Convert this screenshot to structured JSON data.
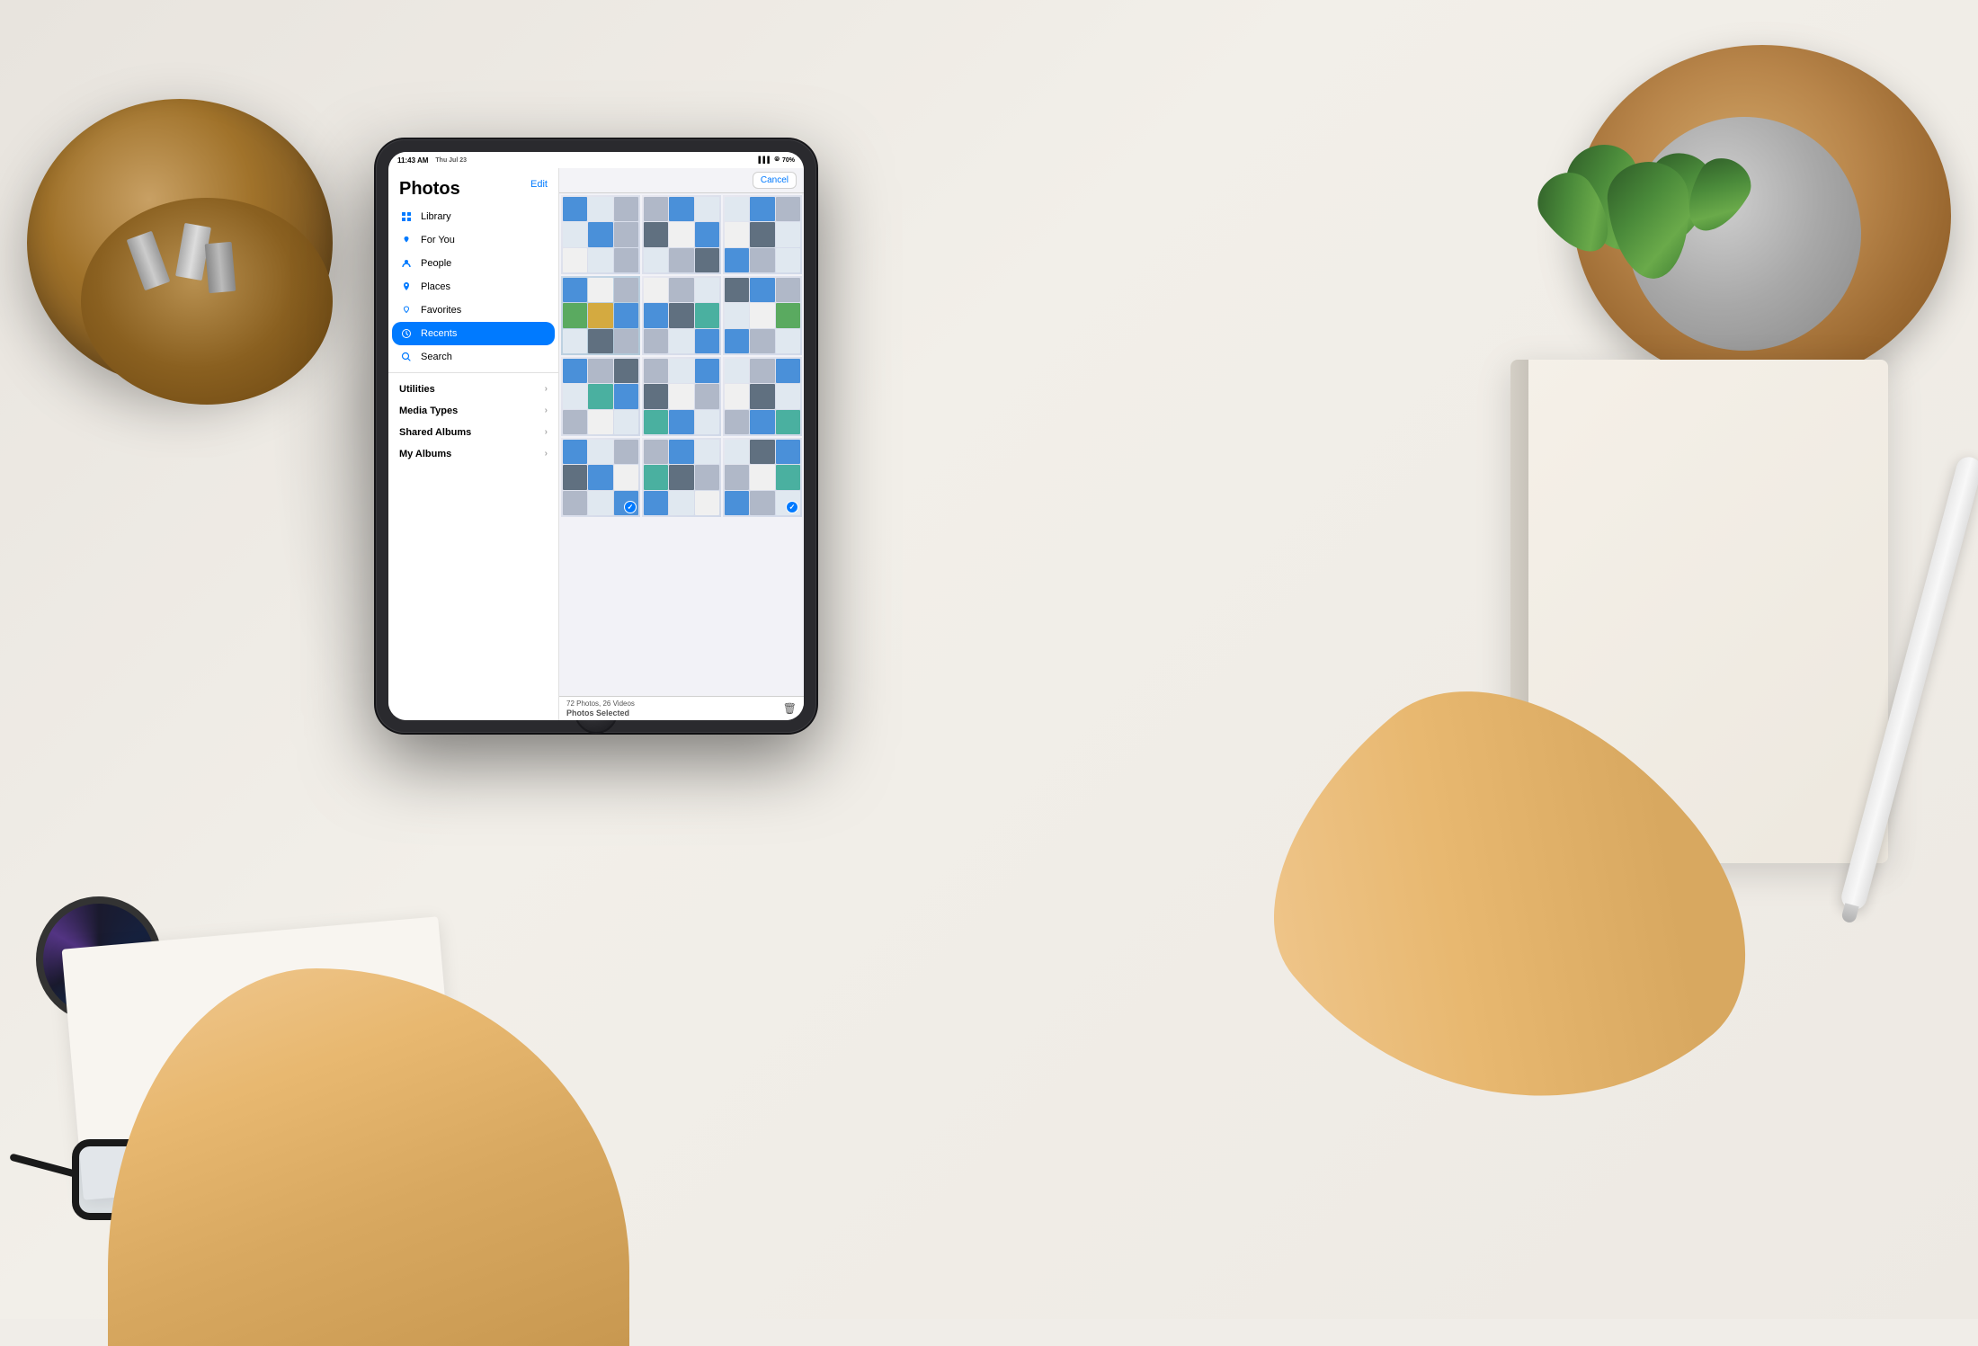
{
  "desk": {
    "background_color": "#f0ede8"
  },
  "status_bar": {
    "time": "11:43 AM",
    "date": "Thu Jul 23",
    "battery": "70%",
    "battery_icon": "battery-icon",
    "wifi_icon": "wifi-icon",
    "signal_icon": "signal-icon"
  },
  "sidebar": {
    "title": "Photos",
    "edit_button": "Edit",
    "nav_items": [
      {
        "id": "library",
        "label": "Library",
        "icon": "⊞",
        "active": false
      },
      {
        "id": "for-you",
        "label": "For You",
        "icon": "⭐",
        "active": false
      },
      {
        "id": "people",
        "label": "People",
        "icon": "👤",
        "active": false
      },
      {
        "id": "places",
        "label": "Places",
        "icon": "📍",
        "active": false
      },
      {
        "id": "favorites",
        "label": "Favorites",
        "icon": "♡",
        "active": false
      },
      {
        "id": "recents",
        "label": "Recents",
        "icon": "🕐",
        "active": true
      },
      {
        "id": "search",
        "label": "Search",
        "icon": "🔍",
        "active": false
      }
    ],
    "sections": [
      {
        "id": "utilities",
        "label": "Utilities",
        "has_chevron": true
      },
      {
        "id": "media-types",
        "label": "Media Types",
        "has_chevron": true
      },
      {
        "id": "shared-albums",
        "label": "Shared Albums",
        "has_chevron": true
      },
      {
        "id": "my-albums",
        "label": "My Albums",
        "has_chevron": true
      }
    ]
  },
  "content": {
    "cancel_button": "Cancel",
    "footer_photos": "72 Photos, 26 Videos",
    "footer_selected": "Photos Selected"
  }
}
